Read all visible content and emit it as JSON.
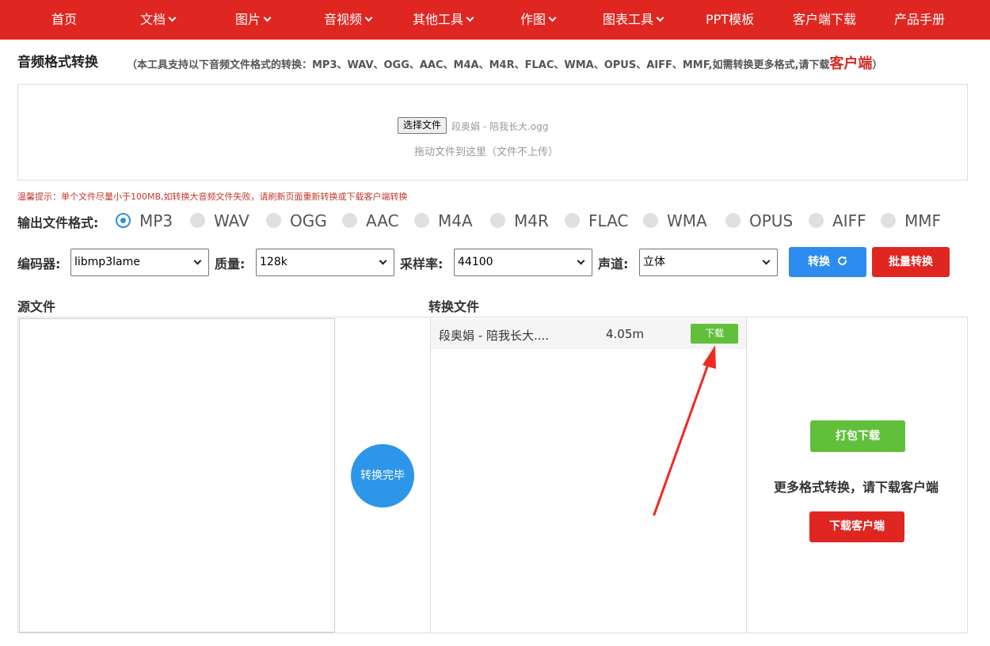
{
  "nav": {
    "items": [
      {
        "label": "首页",
        "has_caret": false
      },
      {
        "label": "文档",
        "has_caret": true
      },
      {
        "label": "图片",
        "has_caret": true
      },
      {
        "label": "音视频",
        "has_caret": true
      },
      {
        "label": "其他工具",
        "has_caret": true
      },
      {
        "label": "作图",
        "has_caret": true
      },
      {
        "label": "图表工具",
        "has_caret": true
      },
      {
        "label": "PPT模板",
        "has_caret": false
      },
      {
        "label": "客户端下载",
        "has_caret": false
      },
      {
        "label": "产品手册",
        "has_caret": false
      }
    ]
  },
  "header": {
    "title": "音频格式转换",
    "description_prefix": "（本工具支持以下音频文件格式的转换：MP3、WAV、OGG、AAC、M4A、M4R、FLAC、WMA、OPUS、AIFF、MMF,如需转换更多格式,请下载",
    "client_link": "客户端",
    "description_suffix": "）"
  },
  "upload": {
    "choose_file_label": "选择文件",
    "selected_file": "段奥娟 - 陪我长大.ogg",
    "drag_hint": "拖动文件到这里（文件不上传）"
  },
  "tip": "温馨提示：单个文件尽量小于100MB,如转换大音频文件失败，请刷新页面重新转换或下载客户端转换",
  "formats": {
    "label": "输出文件格式:",
    "options": [
      "MP3",
      "WAV",
      "OGG",
      "AAC",
      "M4A",
      "M4R",
      "FLAC",
      "WMA",
      "OPUS",
      "AIFF",
      "MMF"
    ],
    "selected": "MP3"
  },
  "settings": {
    "encoder_label": "编码器:",
    "encoder_value": "libmp3lame",
    "quality_label": "质量:",
    "quality_value": "128k",
    "sample_rate_label": "采样率:",
    "sample_rate_value": "44100",
    "channel_label": "声道:",
    "channel_value": "立体",
    "convert_label": "转换",
    "batch_label": "批量转换"
  },
  "sections": {
    "source_title": "源文件",
    "converted_title": "转换文件",
    "status": "转换完毕"
  },
  "results": [
    {
      "name": "段奥娟 - 陪我长大....",
      "size": "4.05m",
      "download_label": "下载"
    }
  ],
  "actions": {
    "pack_download": "打包下载",
    "more_formats": "更多格式转换，请下载客户端",
    "download_client": "下载客户端"
  },
  "colors": {
    "brand_red": "#e02621",
    "accent_blue": "#2d8cf0",
    "success_green": "#61c03b"
  }
}
